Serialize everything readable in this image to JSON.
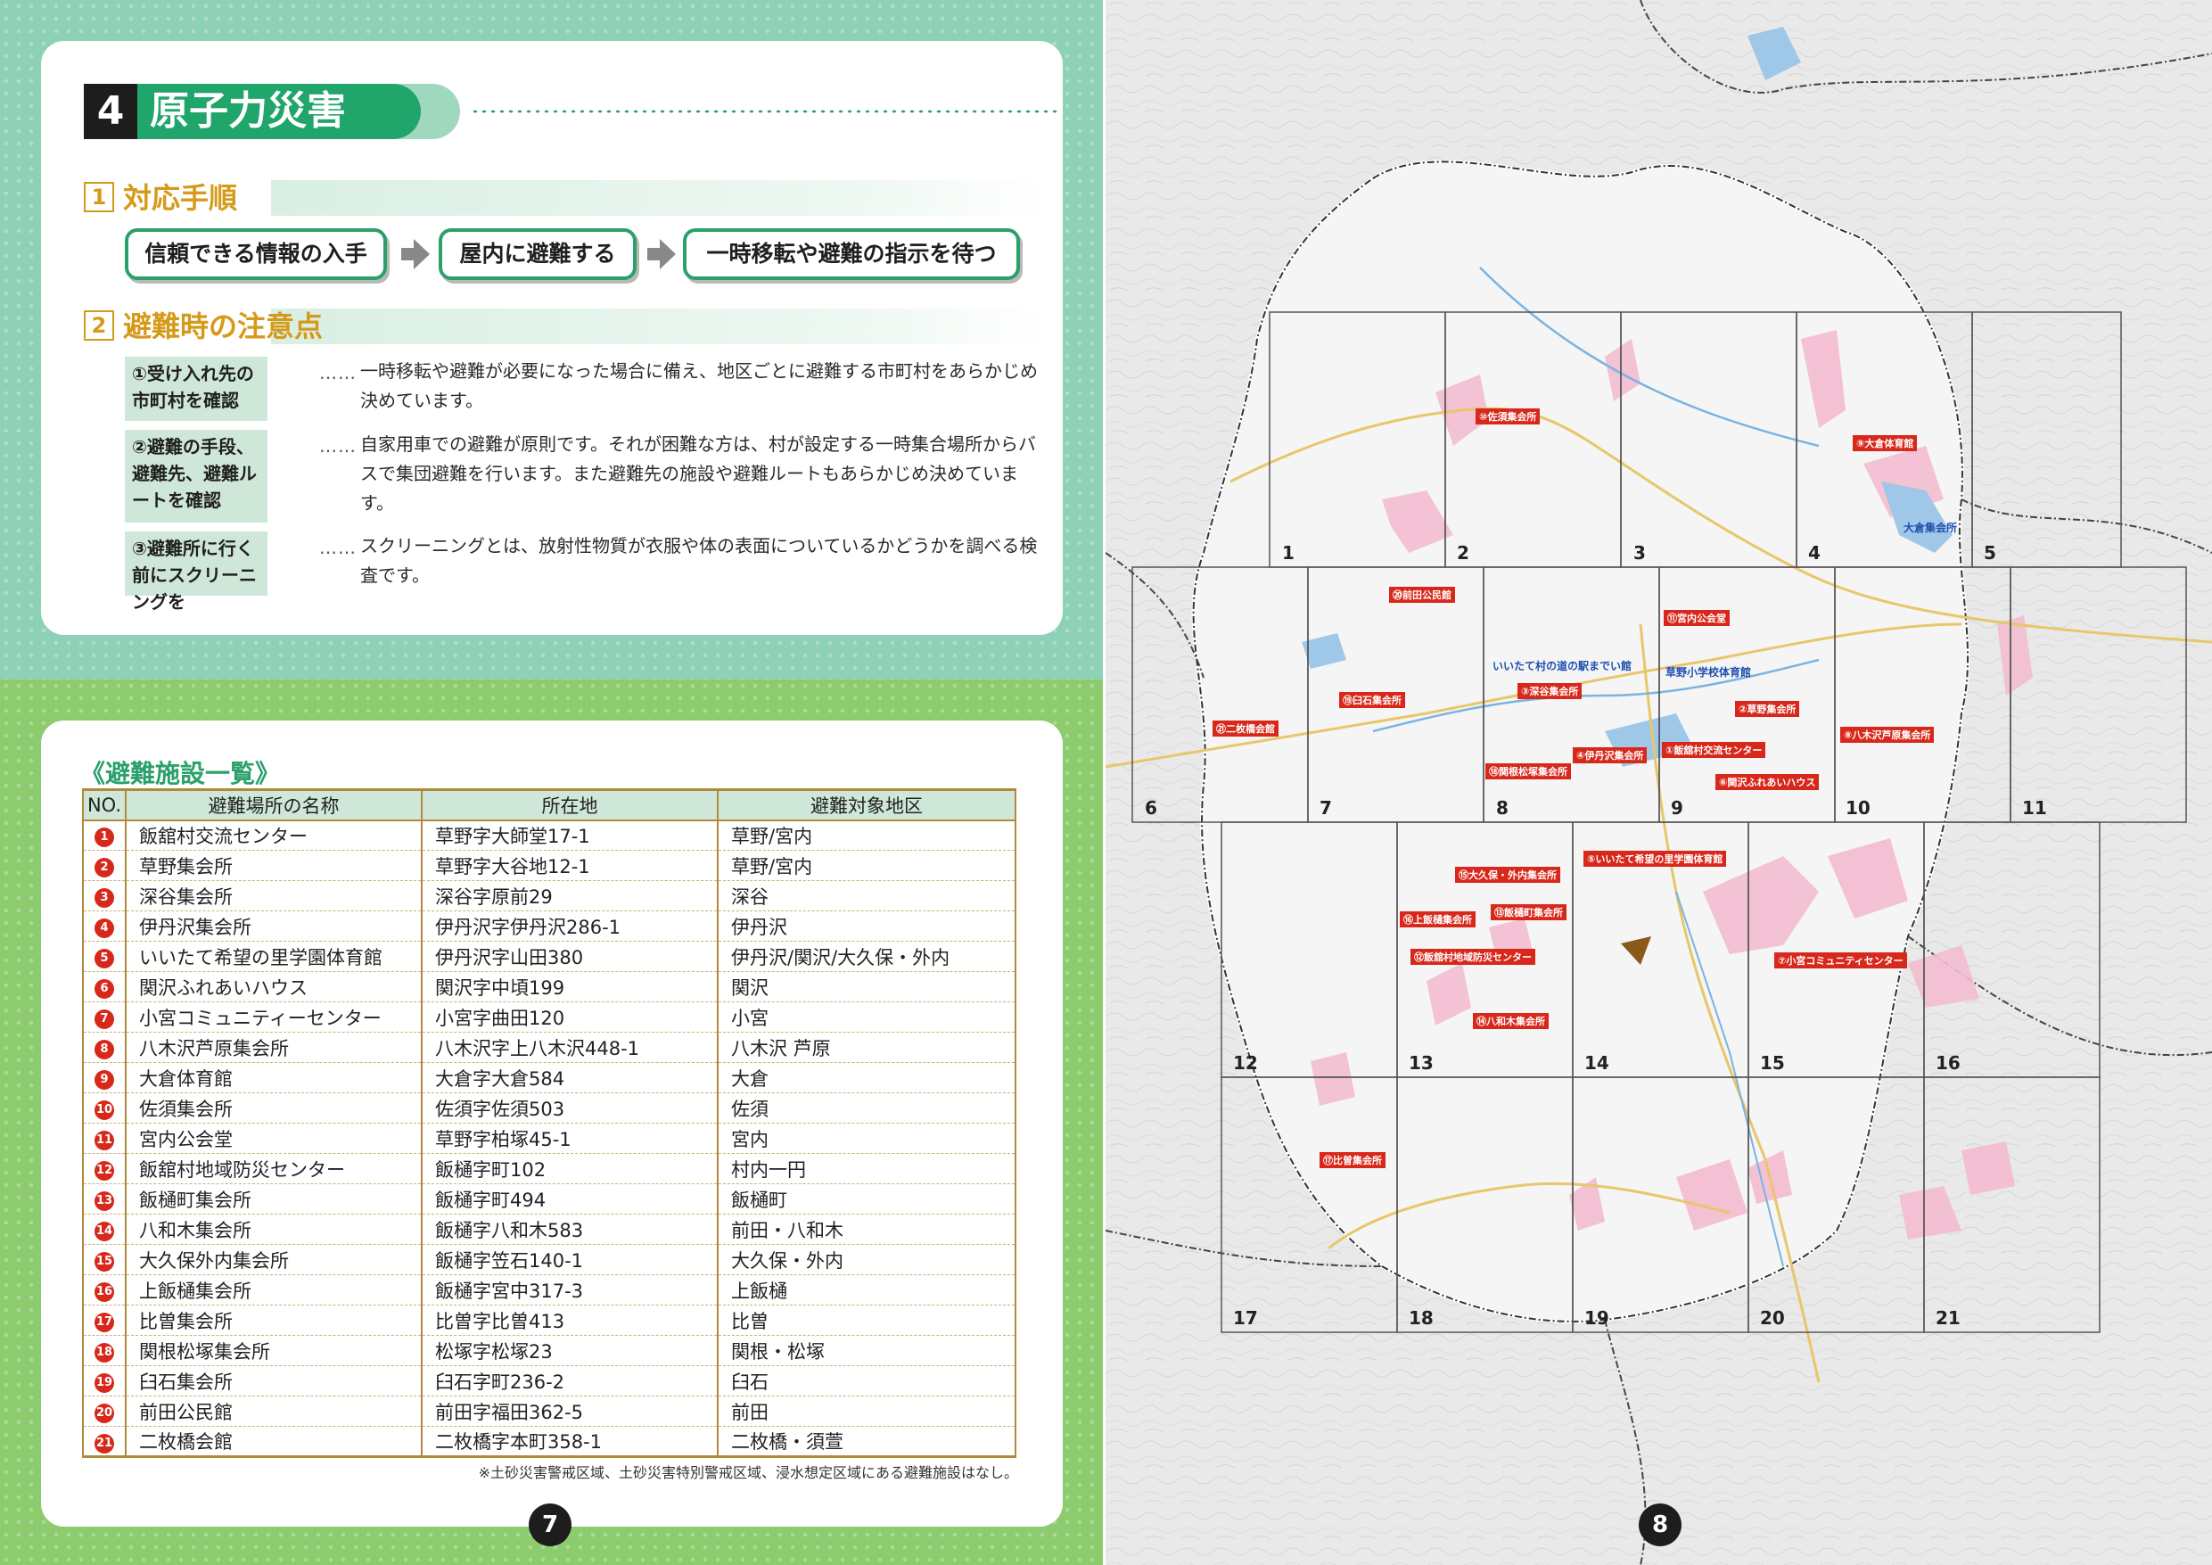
{
  "section": {
    "number": "4",
    "title": "原子力災害"
  },
  "procedure": {
    "number": "1",
    "heading": "対応手順",
    "steps": [
      "信頼できる情報の入手",
      "屋内に避難する",
      "一時移転や避難の指示を待つ"
    ]
  },
  "cautions": {
    "number": "2",
    "heading": "避難時の注意点",
    "leader": "……",
    "items": [
      {
        "label": "①受け入れ先の市町村を確認",
        "text": "一時移転や避難が必要になった場合に備え、地区ごとに避難する市町村をあらかじめ決めています。"
      },
      {
        "label": "②避難の手段、避難先、避難ルートを確認",
        "text": "自家用車での避難が原則です。それが困難な方は、村が設定する一時集合場所からバスで集団避難を行います。また避難先の施設や避難ルートもあらかじめ決めています。"
      },
      {
        "label": "③避難所に行く前にスクリーニングを",
        "text": "スクリーニングとは、放射性物質が衣服や体の表面についているかどうかを調べる検査です。"
      }
    ]
  },
  "facility_table": {
    "title": "《避難施設一覧》",
    "headers": [
      "NO.",
      "避難場所の名称",
      "所在地",
      "避難対象地区"
    ],
    "rows": [
      [
        "1",
        "飯舘村交流センター",
        "草野字大師堂17-1",
        "草野/宮内"
      ],
      [
        "2",
        "草野集会所",
        "草野字大谷地12-1",
        "草野/宮内"
      ],
      [
        "3",
        "深谷集会所",
        "深谷字原前29",
        "深谷"
      ],
      [
        "4",
        "伊丹沢集会所",
        "伊丹沢字伊丹沢286-1",
        "伊丹沢"
      ],
      [
        "5",
        "いいたて希望の里学園体育館",
        "伊丹沢字山田380",
        "伊丹沢/関沢/大久保・外内"
      ],
      [
        "6",
        "関沢ふれあいハウス",
        "関沢字中頃199",
        "関沢"
      ],
      [
        "7",
        "小宮コミュニティーセンター",
        "小宮字曲田120",
        "小宮"
      ],
      [
        "8",
        "八木沢芦原集会所",
        "八木沢字上八木沢448-1",
        "八木沢 芦原"
      ],
      [
        "9",
        "大倉体育館",
        "大倉字大倉584",
        "大倉"
      ],
      [
        "10",
        "佐須集会所",
        "佐須字佐須503",
        "佐須"
      ],
      [
        "11",
        "宮内公会堂",
        "草野字柏塚45-1",
        "宮内"
      ],
      [
        "12",
        "飯舘村地域防災センター",
        "飯樋字町102",
        "村内一円"
      ],
      [
        "13",
        "飯樋町集会所",
        "飯樋字町494",
        "飯樋町"
      ],
      [
        "14",
        "八和木集会所",
        "飯樋字八和木583",
        "前田・八和木"
      ],
      [
        "15",
        "大久保外内集会所",
        "飯樋字笠石140-1",
        "大久保・外内"
      ],
      [
        "16",
        "上飯樋集会所",
        "飯樋字宮中317-3",
        "上飯樋"
      ],
      [
        "17",
        "比曽集会所",
        "比曽字比曽413",
        "比曽"
      ],
      [
        "18",
        "関根松塚集会所",
        "松塚字松塚23",
        "関根・松塚"
      ],
      [
        "19",
        "臼石集会所",
        "臼石字町236-2",
        "臼石"
      ],
      [
        "20",
        "前田公民館",
        "前田字福田362-5",
        "前田"
      ],
      [
        "21",
        "二枚橋会館",
        "二枚橋字本町358-1",
        "二枚橋・須萱"
      ]
    ],
    "footnote": "※土砂災害警戒区域、土砂災害特別警戒区域、浸水想定区域にある避難施設はなし。"
  },
  "page_numbers": {
    "left": "7",
    "right": "8"
  },
  "map": {
    "grid_numbers": [
      "1",
      "2",
      "3",
      "4",
      "5",
      "6",
      "7",
      "8",
      "9",
      "10",
      "11",
      "12",
      "13",
      "14",
      "15",
      "16",
      "17",
      "18",
      "19",
      "20",
      "21"
    ],
    "facility_labels": [
      "⑩佐須集会所",
      "⑨大倉体育館",
      "大倉集会所",
      "⑳前田公民館",
      "⑪宮内公会堂",
      "いいたて村の道の駅までい館",
      "草野小学校体育館",
      "③深谷集会所",
      "⑲臼石集会所",
      "㉑二枚橋会館",
      "②草野集会所",
      "⑧八木沢芦原集会所",
      "④伊丹沢集会所",
      "①飯舘村交流センター",
      "⑱関根松塚集会所",
      "⑥関沢ふれあいハウス",
      "⑤いいたて希望の里学園体育館",
      "⑮大久保・外内集会所",
      "⑯上飯樋集会所",
      "⑬飯樋町集会所",
      "⑫飯舘村地域防災センター",
      "⑦小宮コミュニティセンター",
      "⑭八和木集会所",
      "⑰比曽集会所"
    ]
  },
  "colors": {
    "accent_green": "#20a56b",
    "top_bg": "#8fd1b6",
    "bottom_bg": "#8ccc6e",
    "gold": "#d69a1b",
    "marker_red": "#d7281b"
  }
}
